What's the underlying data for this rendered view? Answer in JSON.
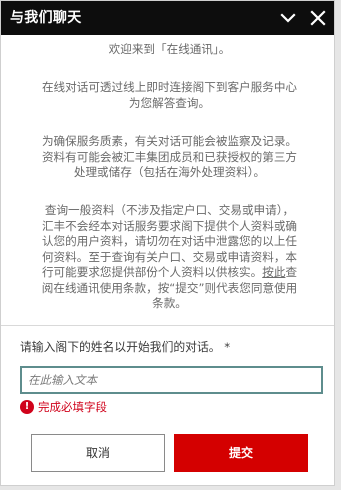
{
  "header": {
    "title": "与我们聊天",
    "minimize_icon": "chevron-down-icon",
    "close_icon": "close-icon",
    "background": "#0d0d0d"
  },
  "notices": {
    "welcome": "欢迎来到「在线通讯」。",
    "intro_line1": "在线对话可透过线上即时连接阁下到客户服务中心",
    "intro_line2": "为您解答查询。",
    "monitor_line1": "为确保服务质素，有关对话可能会被监察及记录。",
    "monitor_line2": "资料有可能会被汇丰集团成员和已获授权的第三方",
    "monitor_line3": "处理或储存（包括在海外处理资料）。",
    "privacy_line1": "查询一般资料（不涉及指定户口、交易或申请），",
    "privacy_line2": "汇丰不会经本对话服务要求阁下提供个人资料或确",
    "privacy_line3": "认您的用户资料，请切勿在对话中泄露您的以上任",
    "privacy_line4": "何资料。至于查询有关户口、交易或申请资料，本",
    "privacy_line5a": "行可能要求您提供部份个人资料以供核实。",
    "privacy_link": "按此",
    "privacy_line5b": "查",
    "privacy_line6": "阅在线通讯使用条款，按“提交”则代表您同意使用",
    "privacy_line7": "条款。"
  },
  "form": {
    "prompt": "请输入阁下的姓名以开始我们的对话。 *",
    "name_placeholder": "在此输入文本",
    "name_value": "",
    "error_icon_glyph": "!",
    "error_text": "完成必填字段",
    "error_color": "#d0021b"
  },
  "buttons": {
    "cancel_label": "取消",
    "submit_label": "提交",
    "submit_color": "#d40000"
  }
}
